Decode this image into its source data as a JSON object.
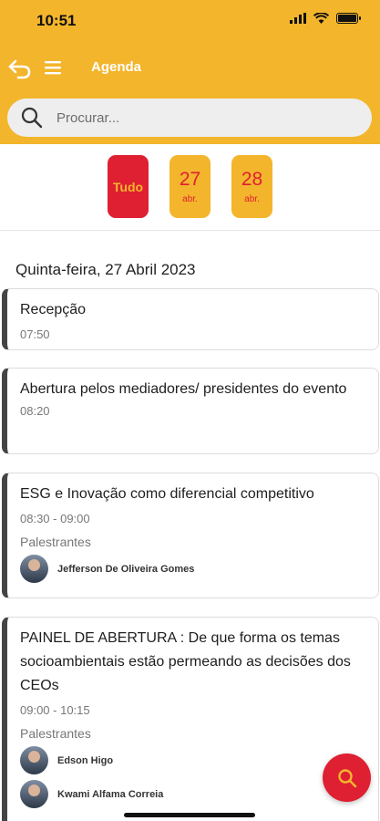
{
  "status_bar": {
    "time": "10:51"
  },
  "header": {
    "title": "Agenda"
  },
  "search": {
    "placeholder": "Procurar..."
  },
  "date_filter": {
    "all_label": "Tudo",
    "days": [
      {
        "day": "27",
        "month": "abr."
      },
      {
        "day": "28",
        "month": "abr."
      }
    ]
  },
  "day_heading": "Quinta-feira, 27 Abril 2023",
  "sessions": [
    {
      "title": "Recepção",
      "time": "07:50"
    },
    {
      "title": "Abertura pelos mediadores/ presidentes do evento",
      "time": "08:20"
    },
    {
      "title": "ESG e Inovação como diferencial competitivo",
      "time": "08:30 - 09:00",
      "speakers_label": "Palestrantes",
      "speakers": [
        "Jefferson De Oliveira Gomes"
      ]
    },
    {
      "title": "PAINEL DE ABERTURA : De que forma os temas socioambientais estão permeando as decisões dos CEOs",
      "time": "09:00 - 10:15",
      "speakers_label": "Palestrantes",
      "speakers": [
        "Edson Higo",
        "Kwami Alfama Correia"
      ]
    }
  ],
  "colors": {
    "accent": "#f3b52c",
    "primary": "#df1f32"
  }
}
